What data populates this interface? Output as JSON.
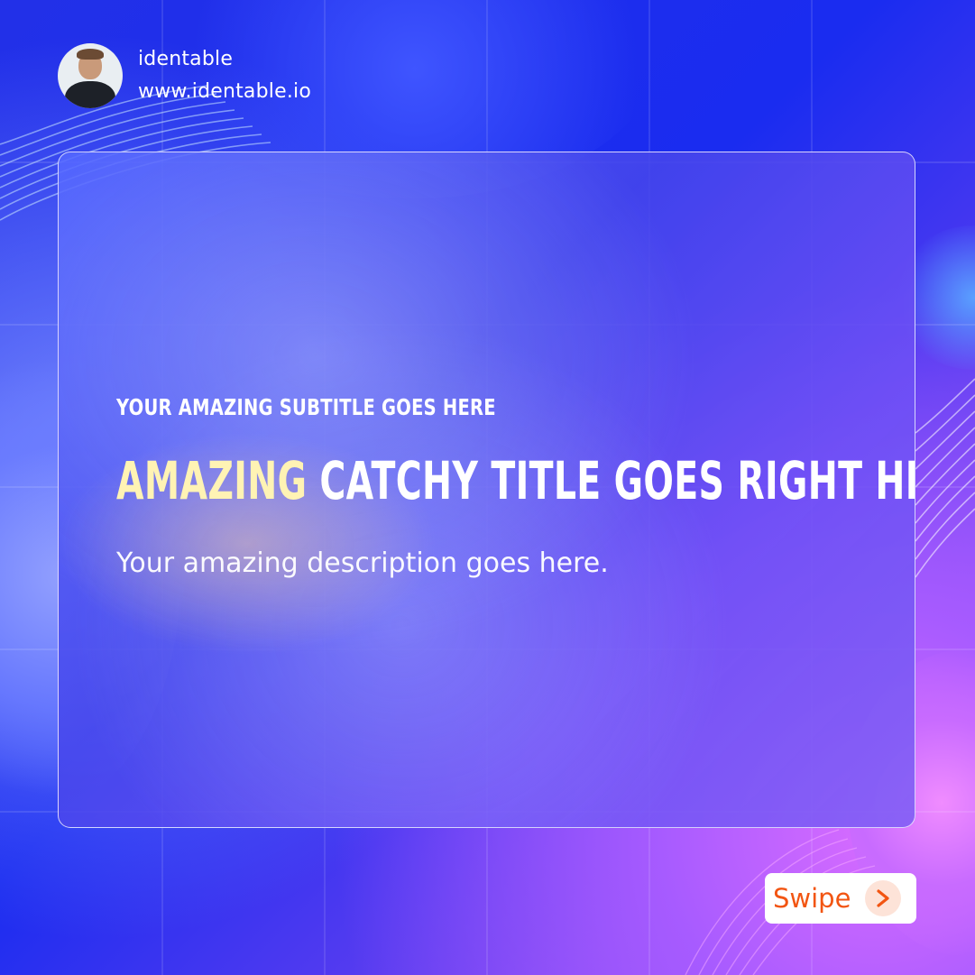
{
  "header": {
    "avatar_icon": "user-avatar-photo",
    "brand_name": "identable",
    "website": "www.identable.io"
  },
  "card": {
    "subtitle": "YOUR AMAZING SUBTITLE GOES HERE",
    "title_highlight": "AMAZING",
    "title_rest": " CATCHY TITLE GOES RIGHT HERE!",
    "description": "Your amazing description goes here."
  },
  "swipe_button": {
    "label": "Swipe",
    "icon": "chevron-right-icon"
  },
  "colors": {
    "background_primary": "#1f2ff0",
    "background_accent": "#b95ff5",
    "title_highlight": "#fff3b4",
    "swipe_text": "#f25512",
    "swipe_icon_bg": "#fde3d8"
  }
}
